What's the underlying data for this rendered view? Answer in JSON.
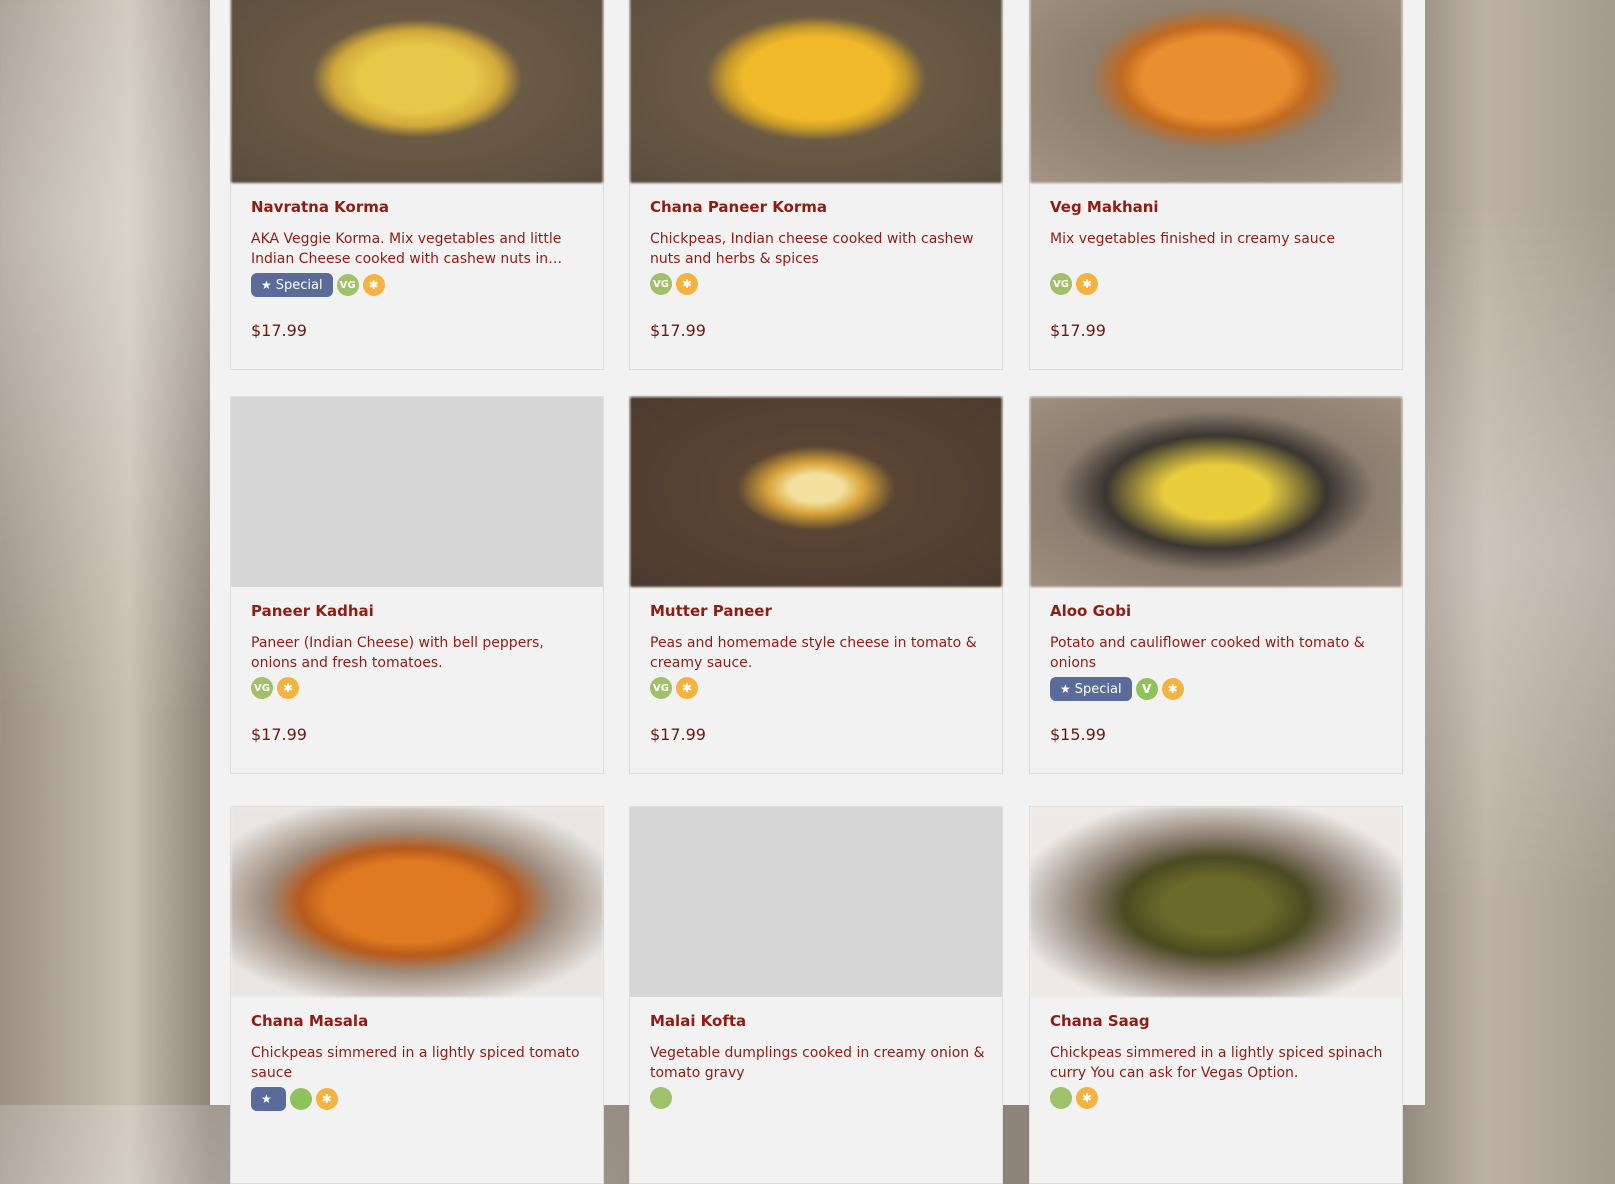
{
  "cards": [
    {
      "name": "Navratna Korma",
      "desc": "AKA Veggie Korma. Mix vegetables and little Indian Cheese cooked with cashew nuts in…",
      "special": "Special",
      "diet": [
        "VG",
        "GF"
      ],
      "price": "$17.99",
      "image": "blurred yellow curry in bowl"
    },
    {
      "name": "Chana Paneer Korma",
      "desc": "Chickpeas, Indian cheese cooked with cashew nuts and herbs & spices",
      "special": "",
      "diet": [
        "VG",
        "GF"
      ],
      "price": "$17.99",
      "image": "blurred yellow curry in bowl"
    },
    {
      "name": "Veg Makhani",
      "desc": "Mix vegetables finished in creamy sauce",
      "special": "",
      "diet": [
        "VG",
        "GF"
      ],
      "price": "$17.99",
      "image": "blurred orange curry"
    },
    {
      "name": "Paneer Kadhai",
      "desc": "Paneer (Indian Cheese) with bell peppers, onions and fresh tomatoes.",
      "special": "",
      "diet": [
        "VG",
        "GF"
      ],
      "price": "$17.99",
      "image": ""
    },
    {
      "name": "Mutter Paneer",
      "desc": "Peas and homemade style cheese in tomato & creamy sauce.",
      "special": "",
      "diet": [
        "VG",
        "GF"
      ],
      "price": "$17.99",
      "image": "blurred curry in dark bowl"
    },
    {
      "name": "Aloo Gobi",
      "desc": "Potato and cauliflower cooked with tomato & onions",
      "special": "Special",
      "diet": [
        "V",
        "GF"
      ],
      "price": "$15.99",
      "image": "blurred aloo gobi in bowl"
    },
    {
      "name": "Chana Masala",
      "desc": "Chickpeas simmered in a lightly spiced tomato sauce",
      "special": "",
      "diet": [],
      "price": "",
      "image": "blurred orange curry"
    },
    {
      "name": "Malai Kofta",
      "desc": "Vegetable dumplings cooked in creamy onion & tomato gravy",
      "special": "",
      "diet": [],
      "price": "",
      "image": ""
    },
    {
      "name": "Chana Saag",
      "desc": "Chickpeas simmered in a lightly spiced spinach curry You can ask for Vegas Option.",
      "special": "",
      "diet": [],
      "price": "",
      "image": "blurred green curry in bowl"
    }
  ],
  "icons": {
    "star": "star-icon",
    "vg": "vegan-icon",
    "v": "vegetarian-icon",
    "gf": "gluten-free-icon"
  },
  "colors": {
    "name": "#8f1d12",
    "price": "#6b1a0e",
    "special_bg": "#5b6b99",
    "vg": "#a0c06a",
    "gf": "#f4b240"
  }
}
